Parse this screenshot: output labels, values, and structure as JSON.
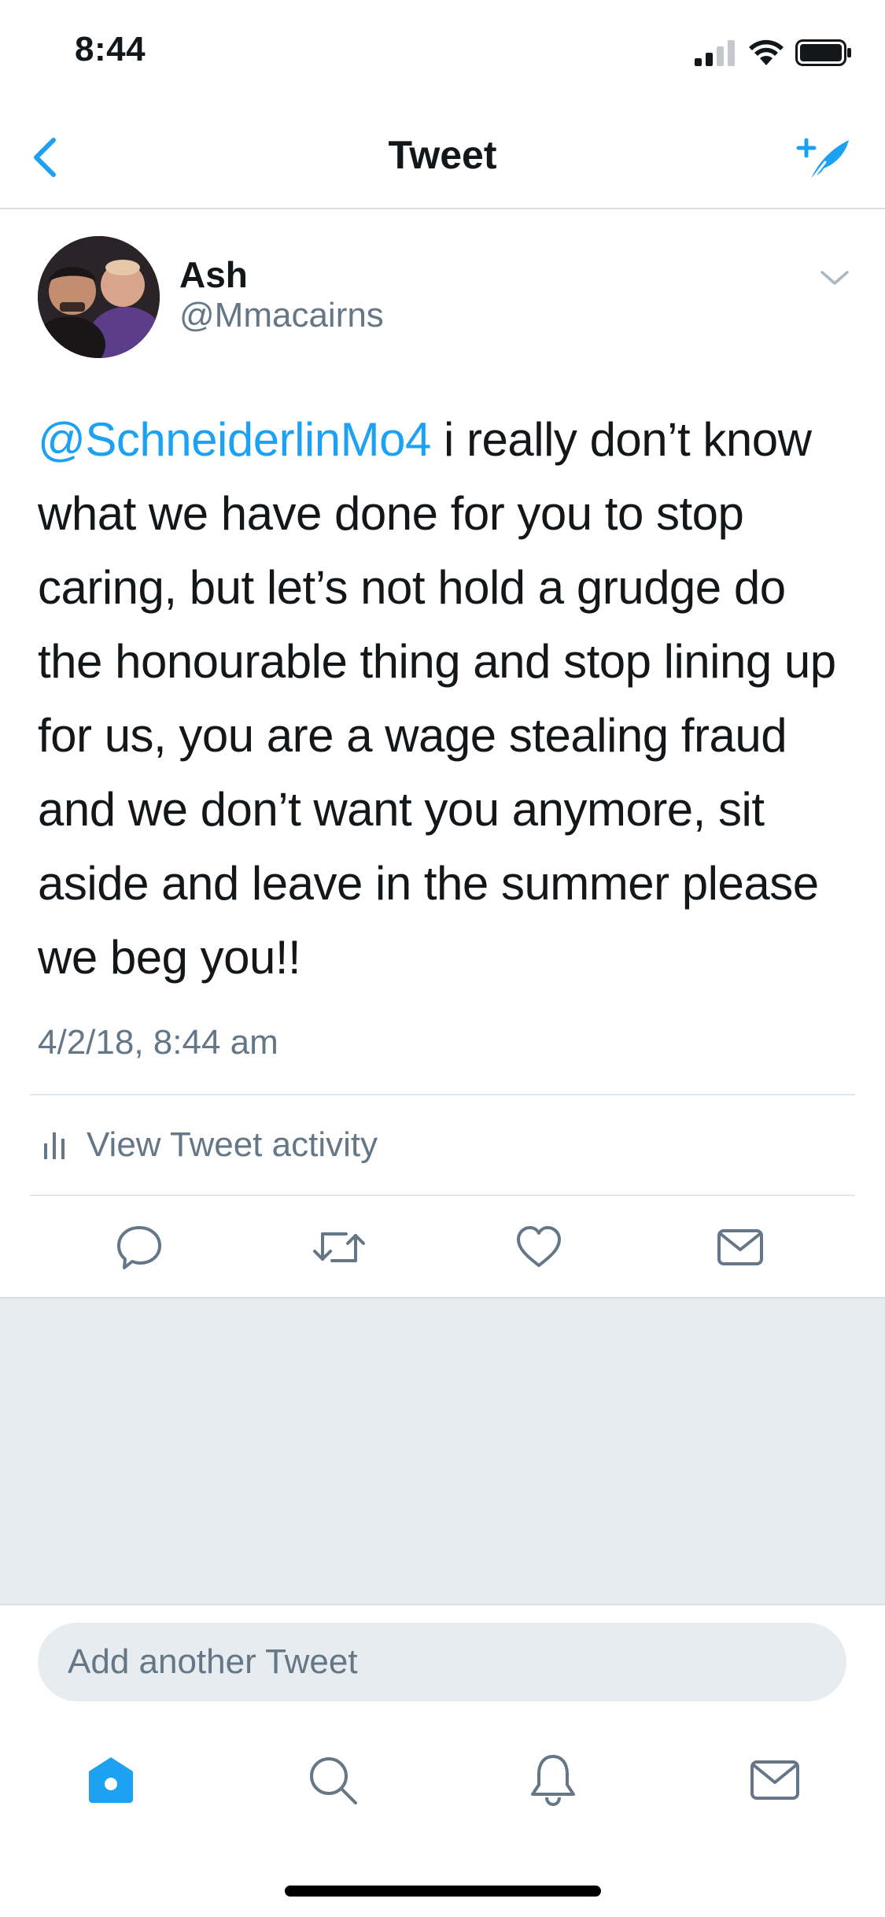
{
  "status_bar": {
    "time": "8:44",
    "icons": [
      "signal-icon",
      "wifi-icon",
      "battery-icon"
    ]
  },
  "nav": {
    "title": "Tweet",
    "back_icon": "chevron-left-icon",
    "compose_icon": "compose-tweet-icon"
  },
  "tweet": {
    "author_name": "Ash",
    "author_handle": "@Mmacairns",
    "mention": "@SchneiderlinMo4",
    "body": " i really don’t know what we have done for you to stop caring, but let’s not hold a grudge do the honourable thing and stop lining up for us, you are a wage stealing fraud and we don’t want you anymore, sit aside and leave in the summer please we beg you!!",
    "timestamp": "4/2/18, 8:44 am",
    "activity_label": "View Tweet activity"
  },
  "actions": [
    "reply-icon",
    "retweet-icon",
    "like-icon",
    "direct-message-icon"
  ],
  "reply": {
    "placeholder": "Add another Tweet"
  },
  "tab_bar": [
    "home-icon",
    "search-icon",
    "notifications-icon",
    "messages-icon"
  ],
  "colors": {
    "accent": "#1da1f2",
    "secondary_text": "#657786",
    "primary_text": "#14171a",
    "background_grey": "#e6ecf0",
    "divider": "#e1e8ed"
  }
}
